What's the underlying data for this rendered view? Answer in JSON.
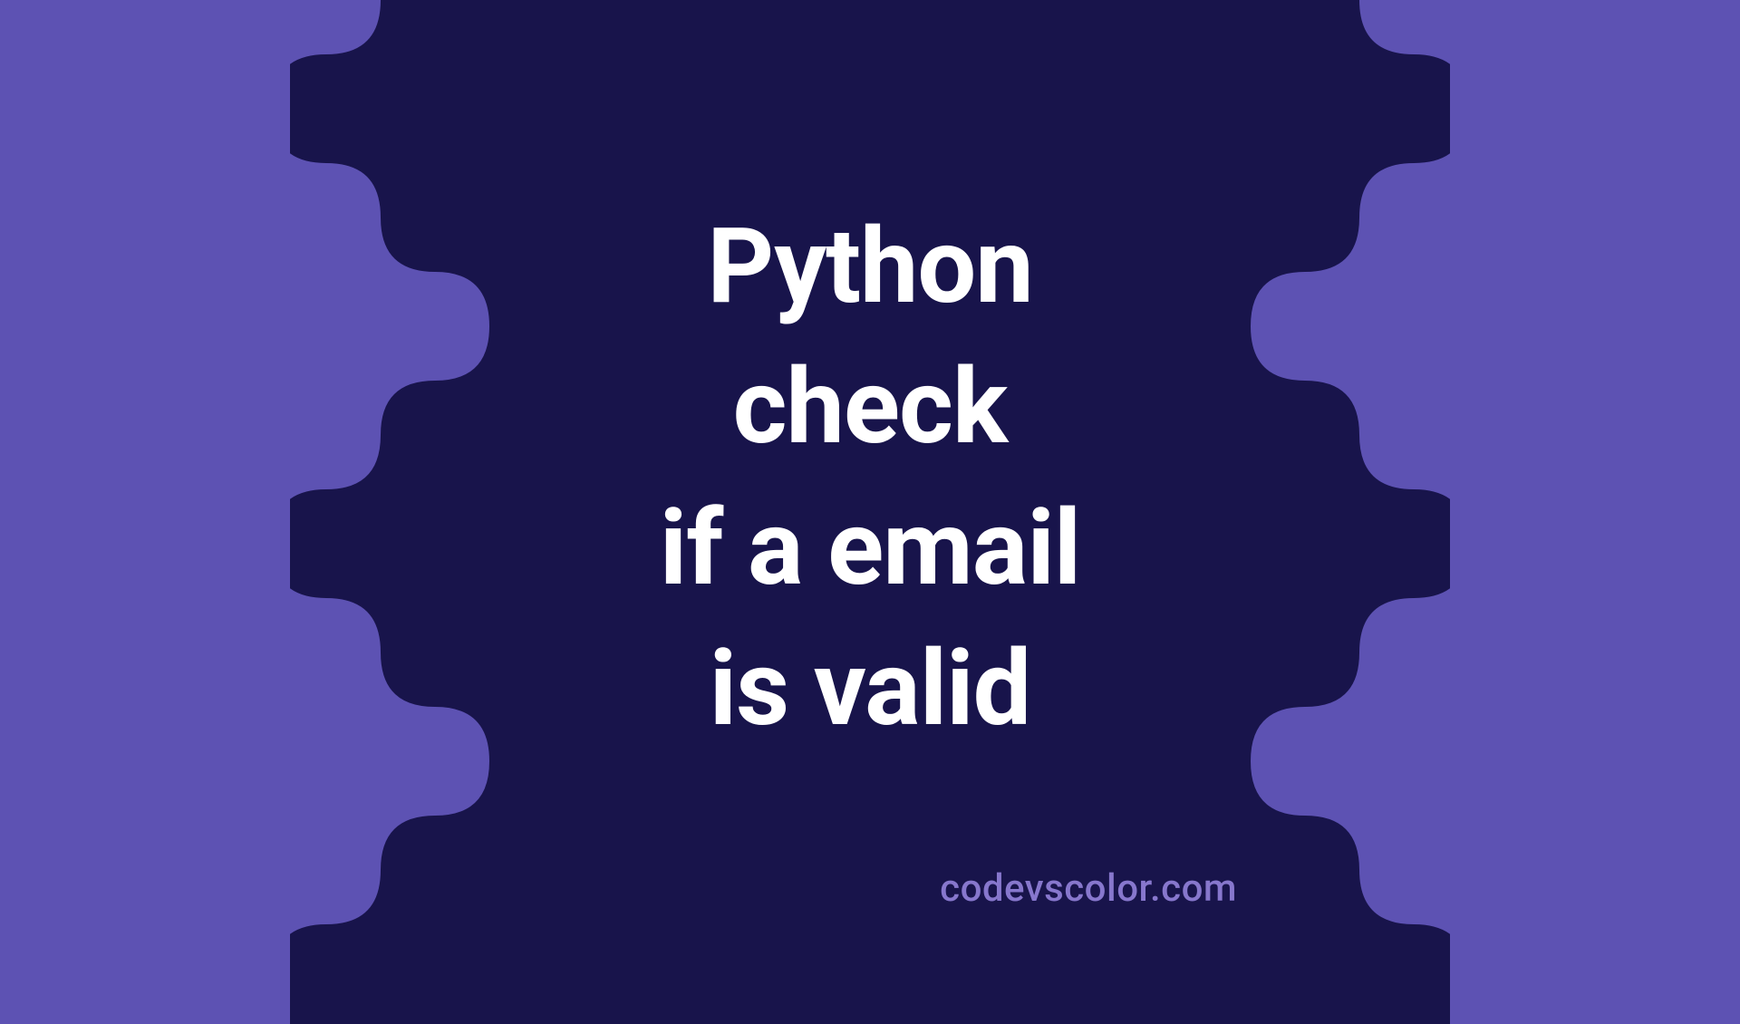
{
  "title_line1": "Python",
  "title_line2": "check",
  "title_line3": "if a email",
  "title_line4": "is valid",
  "watermark": "codevscolor.com",
  "colors": {
    "background": "#5d52b3",
    "blob": "#18144b",
    "text": "#ffffff",
    "watermark": "#8777cd"
  }
}
